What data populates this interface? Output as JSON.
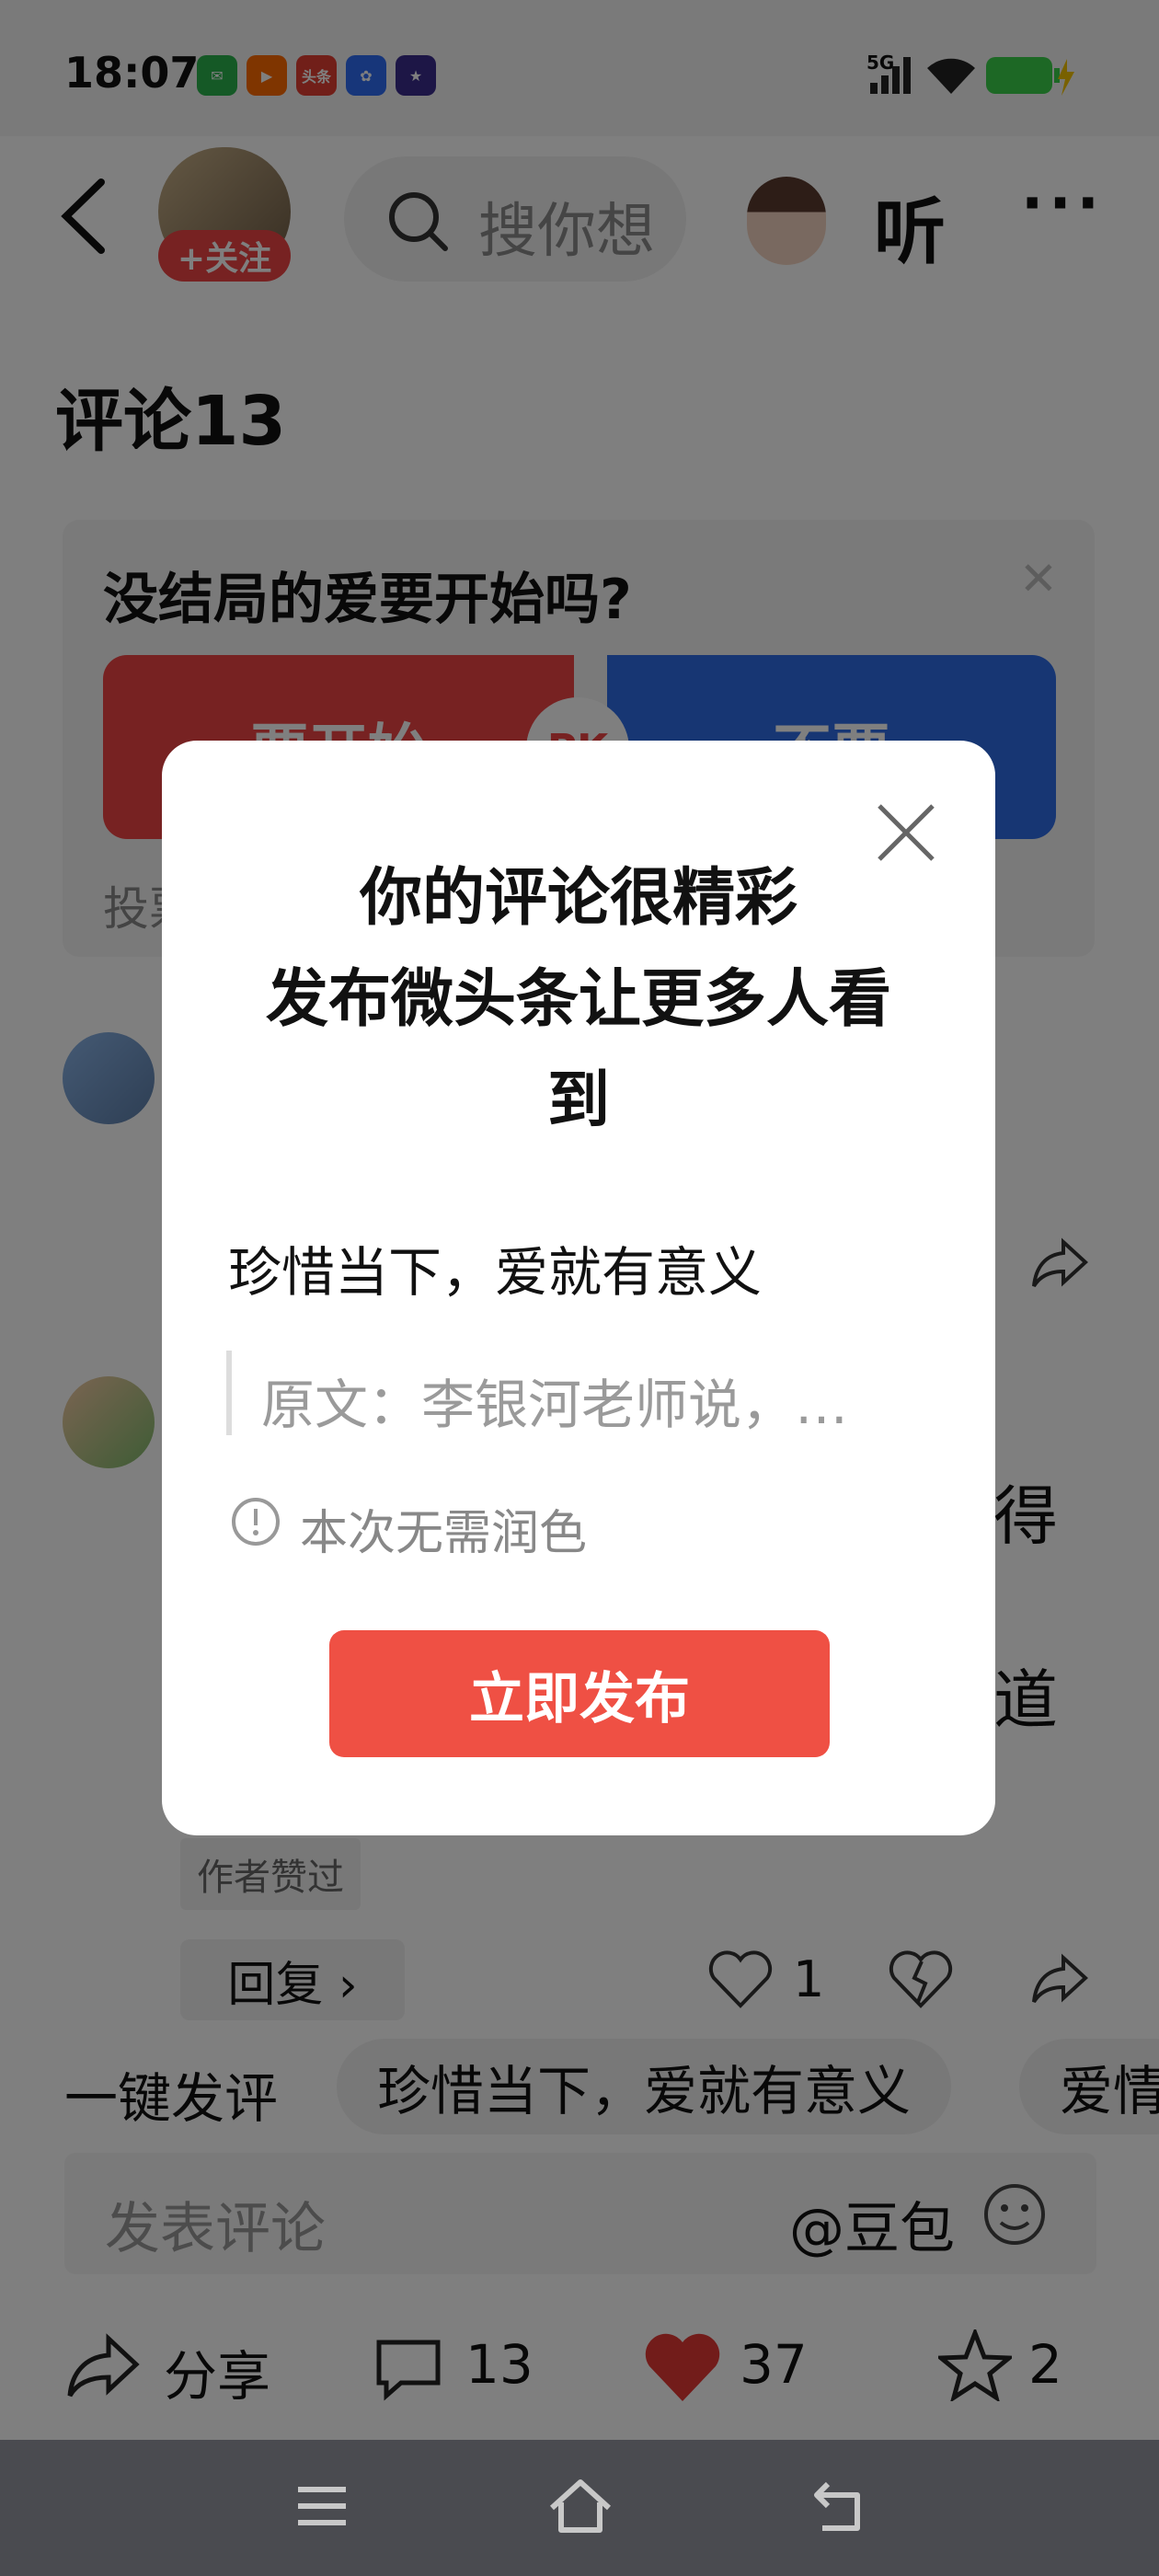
{
  "status_bar": {
    "time": "18:07",
    "apps": [
      {
        "icon": "wechat-icon",
        "label": "",
        "color": "#2bb24c"
      },
      {
        "icon": "kuaishou-icon",
        "label": "",
        "color": "#ff6a00"
      },
      {
        "icon": "toutiao-icon",
        "label": "头条",
        "color": "#e33e33"
      },
      {
        "icon": "baidu-icon",
        "label": "",
        "color": "#2e6cf5"
      },
      {
        "icon": "game-icon",
        "label": "",
        "color": "#3a2d8c"
      }
    ],
    "network": "5G"
  },
  "header": {
    "follow_label": "+关注",
    "search_placeholder": "搜你想",
    "listen_label": "听"
  },
  "comments_title": "评论13",
  "poll": {
    "question": "没结局的爱要开始吗?",
    "yes_label": "要开始",
    "no_label": "不要",
    "pk_label": "PK",
    "vote_label": "投票"
  },
  "comments": {
    "right_fragment_1": "得",
    "right_fragment_2": "道",
    "author_liked_label": "作者赞过",
    "reply_label": "回复 ›",
    "like_count": "1"
  },
  "quick_comment": {
    "label": "一键发评",
    "chips": [
      "珍惜当下，爱就有意义",
      "爱情"
    ]
  },
  "comment_input": {
    "placeholder": "发表评论",
    "mention": "@豆包"
  },
  "bottom_bar": {
    "share_label": "分享",
    "comment_count": "13",
    "like_count": "37",
    "favorite_count": "2"
  },
  "dialog": {
    "title": "你的评论很精彩\n发布微头条让更多人看\n到",
    "comment_text": "珍惜当下，爱就有意义",
    "quote_text": "原文：李银河老师说，…",
    "polish_note": "本次无需润色",
    "publish_label": "立即发布"
  },
  "colors": {
    "accent_red": "#ef5044",
    "poll_blue": "#2f6de6"
  }
}
